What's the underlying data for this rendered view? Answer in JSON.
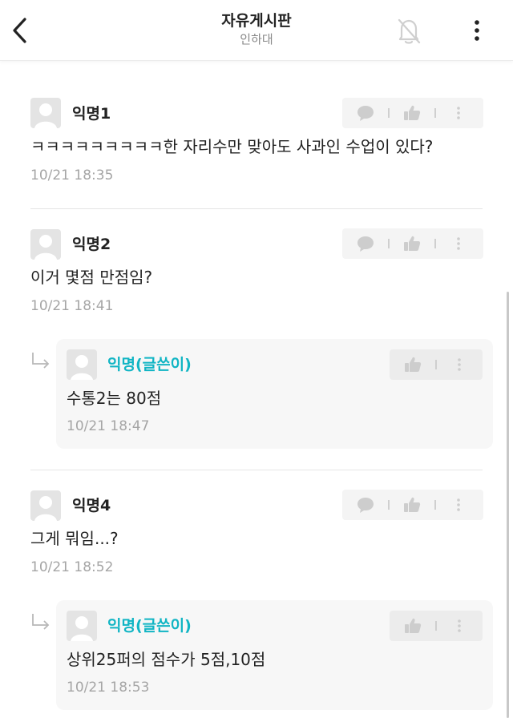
{
  "header": {
    "title": "자유게시판",
    "subtitle": "인하대"
  },
  "icons": {
    "back": "chevron-left-icon",
    "notifications": "bell-off-icon",
    "more": "more-vertical-icon",
    "comment": "speech-bubble-icon",
    "like": "thumbs-up-icon",
    "options": "kebab-icon",
    "reply": "reply-arrow-icon"
  },
  "colors": {
    "op_author": "#11b5c4",
    "time": "#a5a5a5",
    "action_bg": "#f4f4f4"
  },
  "comments": [
    {
      "author": "익명1",
      "text": "ㅋㅋㅋㅋㅋㅋㅋㅋㅋ한 자리수만 맞아도 사과인 수업이 있다?",
      "time": "10/21 18:35"
    },
    {
      "author": "익명2",
      "text": "이거 몇점 만점임?",
      "time": "10/21 18:41",
      "reply": {
        "author": "익명(글쓴이)",
        "text": "수통2는 80점",
        "time": "10/21 18:47"
      }
    },
    {
      "author": "익명4",
      "text": "그게 뭐임...?",
      "time": "10/21 18:52",
      "reply": {
        "author": "익명(글쓴이)",
        "text": "상위25퍼의 점수가 5점,10점",
        "time": "10/21 18:53"
      }
    }
  ]
}
